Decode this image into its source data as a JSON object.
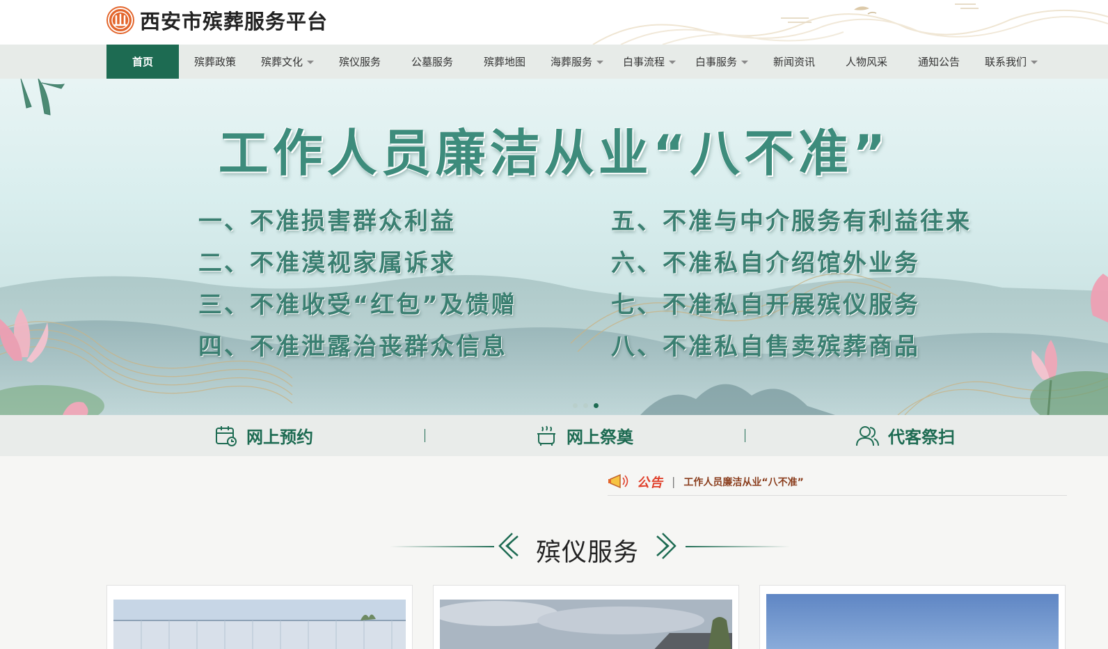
{
  "site": {
    "title": "西安市殡葬服务平台"
  },
  "nav": {
    "items": [
      {
        "label": "首页",
        "active": true,
        "dropdown": false
      },
      {
        "label": "殡葬政策",
        "active": false,
        "dropdown": false
      },
      {
        "label": "殡葬文化",
        "active": false,
        "dropdown": true
      },
      {
        "label": "殡仪服务",
        "active": false,
        "dropdown": false
      },
      {
        "label": "公墓服务",
        "active": false,
        "dropdown": false
      },
      {
        "label": "殡葬地图",
        "active": false,
        "dropdown": false
      },
      {
        "label": "海葬服务",
        "active": false,
        "dropdown": true
      },
      {
        "label": "白事流程",
        "active": false,
        "dropdown": true
      },
      {
        "label": "白事服务",
        "active": false,
        "dropdown": true
      },
      {
        "label": "新闻资讯",
        "active": false,
        "dropdown": false
      },
      {
        "label": "人物风采",
        "active": false,
        "dropdown": false
      },
      {
        "label": "通知公告",
        "active": false,
        "dropdown": false
      },
      {
        "label": "联系我们",
        "active": false,
        "dropdown": true
      }
    ]
  },
  "banner": {
    "title": "工作人员廉洁从业“八不准”",
    "rules_left": [
      "一、不准损害群众利益",
      "二、不准漠视家属诉求",
      "三、不准收受“红包”及馈赠",
      "四、不准泄露治丧群众信息"
    ],
    "rules_right": [
      "五、不准与中介服务有利益往来",
      "六、不准私自介绍馆外业务",
      "七、不准私自开展殡仪服务",
      "八、不准私自售卖殡葬商品"
    ],
    "slide_count": 3,
    "active_slide": 3
  },
  "quick": {
    "reserve": "网上预约",
    "memorial": "网上祭奠",
    "sweep": "代客祭扫"
  },
  "notice": {
    "label": "公告",
    "text": "工作人员廉洁从业“八不准”"
  },
  "section": {
    "title": "殡仪服务"
  },
  "colors": {
    "primary": "#1d6b52",
    "nav_bg": "#e7ebe8",
    "logo": "#e3652b",
    "notice_label": "#e0402b",
    "banner_text": "#3d8c7c"
  }
}
